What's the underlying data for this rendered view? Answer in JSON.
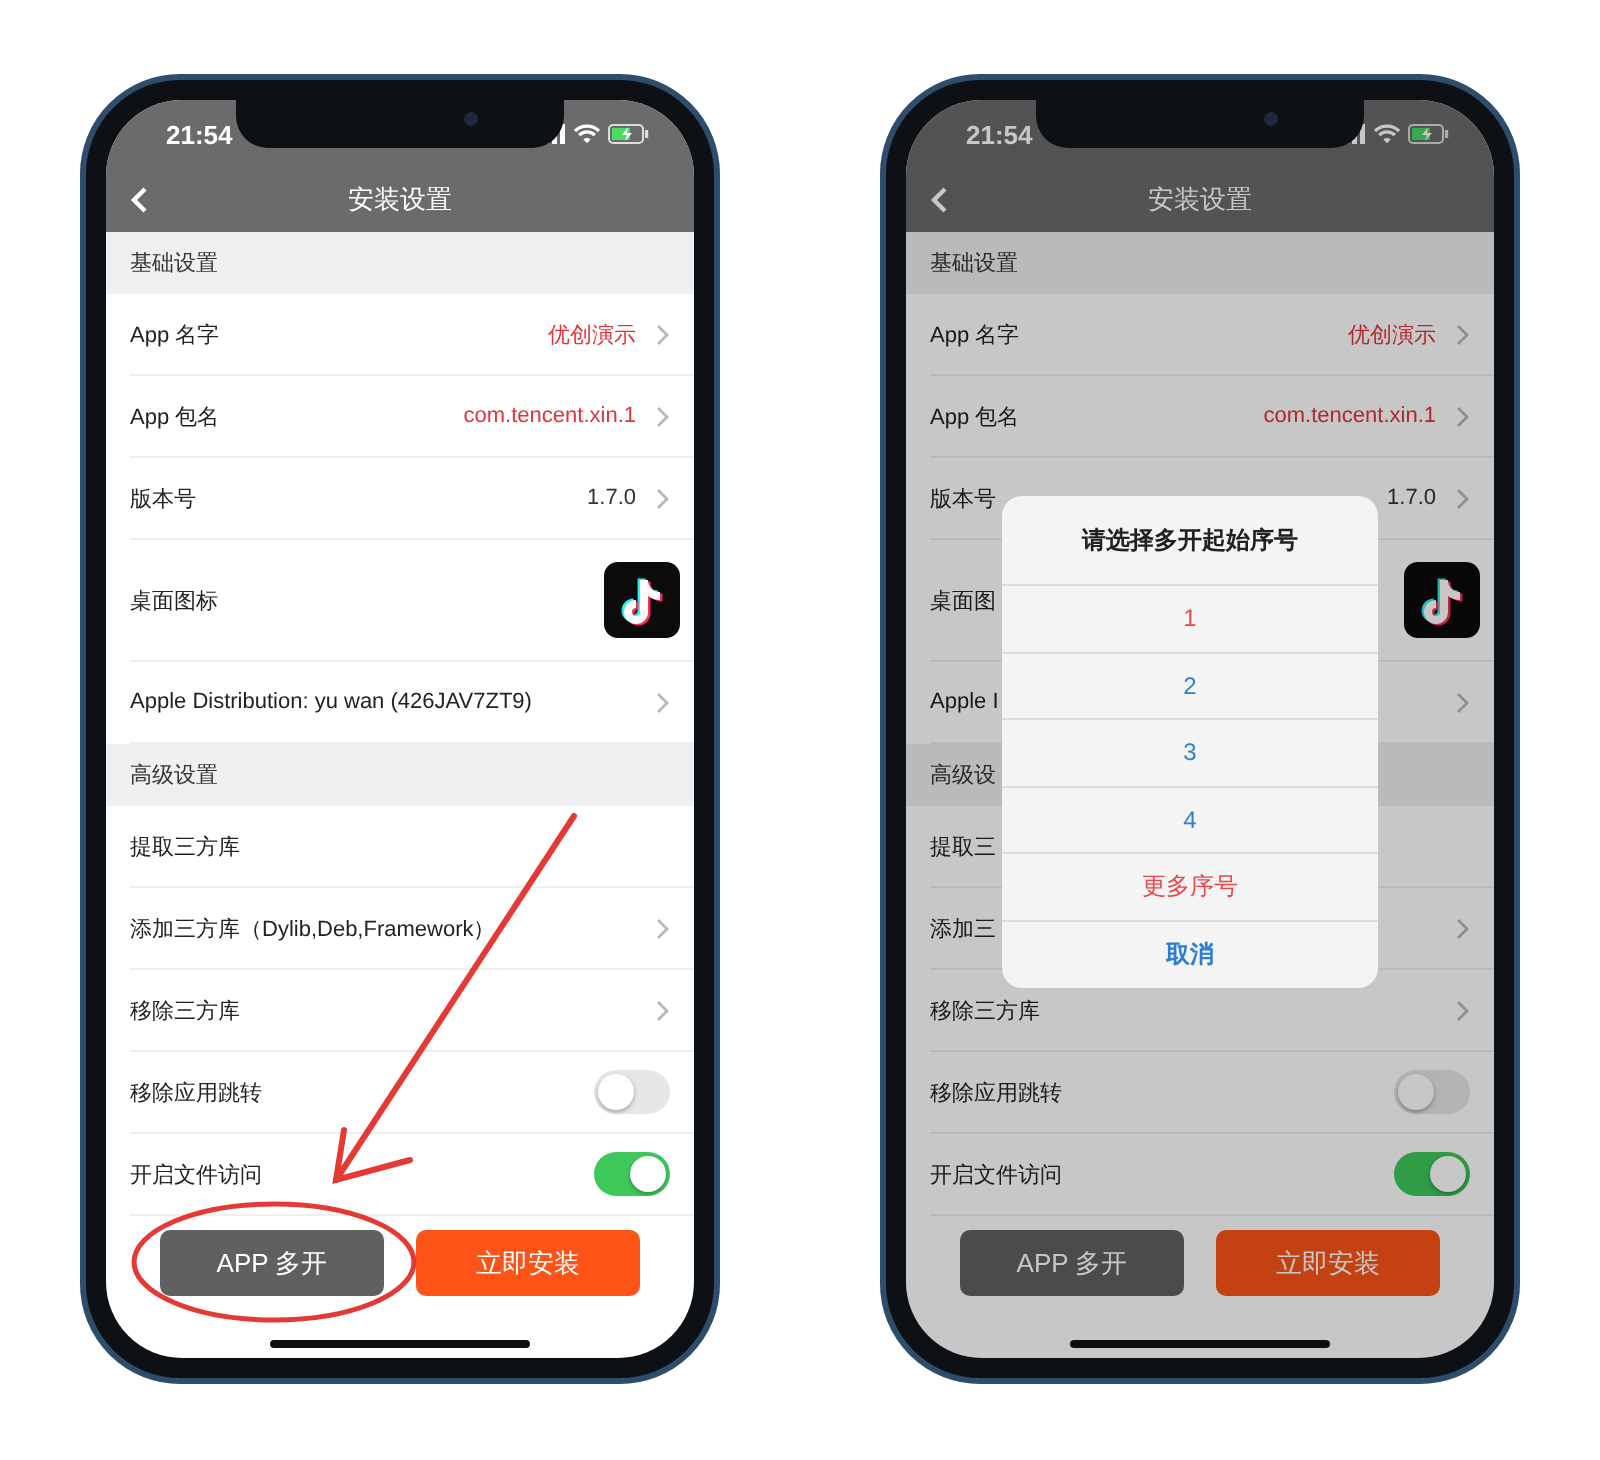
{
  "phones": [
    {
      "annotated": true,
      "status_bar": {
        "time": "21:54"
      },
      "nav": {
        "title": "安装设置"
      },
      "sections": [
        {
          "header": "基础设置",
          "rows": [
            {
              "kind": "value",
              "label": "App 名字",
              "value": "优创演示",
              "highlighted": true
            },
            {
              "kind": "value",
              "label": "App 包名",
              "value": "com.tencent.xin.1",
              "highlighted": true
            },
            {
              "kind": "value",
              "label": "版本号",
              "value": "1.7.0",
              "highlighted": false
            },
            {
              "kind": "icon",
              "label": "桌面图标"
            },
            {
              "kind": "link",
              "label": "Apple Distribution: yu wan (426JAV7ZT9)"
            }
          ]
        },
        {
          "header": "高级设置",
          "rows": [
            {
              "kind": "plain",
              "label": "提取三方库"
            },
            {
              "kind": "link",
              "label": "添加三方库（Dylib,Deb,Framework）"
            },
            {
              "kind": "link",
              "label": "移除三方库"
            },
            {
              "kind": "toggle",
              "label": "移除应用跳转",
              "on": false
            },
            {
              "kind": "toggle",
              "label": "开启文件访问",
              "on": true
            }
          ]
        }
      ],
      "buttons": [
        {
          "kind": "secondary",
          "label": "APP 多开"
        },
        {
          "kind": "primary",
          "label": "立即安装"
        }
      ]
    },
    {
      "annotated": false,
      "status_bar": {
        "time": "21:54"
      },
      "nav": {
        "title": "安装设置"
      },
      "sections": [
        {
          "header": "基础设置",
          "rows": [
            {
              "kind": "value",
              "label": "App 名字",
              "value": "优创演示",
              "highlighted": true
            },
            {
              "kind": "value",
              "label": "App 包名",
              "value": "com.tencent.xin.1",
              "highlighted": true
            },
            {
              "kind": "value",
              "label": "版本号",
              "value": "1.7.0",
              "highlighted": false
            },
            {
              "kind": "icon",
              "label": "桌面图"
            },
            {
              "kind": "link",
              "label": "Apple I"
            }
          ]
        },
        {
          "header": "高级设",
          "rows": [
            {
              "kind": "plain",
              "label": "提取三"
            },
            {
              "kind": "link",
              "label": "添加三"
            },
            {
              "kind": "link",
              "label": "移除三方库"
            },
            {
              "kind": "toggle",
              "label": "移除应用跳转",
              "on": false
            },
            {
              "kind": "toggle",
              "label": "开启文件访问",
              "on": true
            }
          ]
        }
      ],
      "buttons": [
        {
          "kind": "secondary",
          "label": "APP 多开"
        },
        {
          "kind": "primary",
          "label": "立即安装"
        }
      ],
      "dialog": {
        "title": "请选择多开起始序号",
        "options": [
          {
            "kind": "alert",
            "label": "1"
          },
          {
            "kind": "normal",
            "label": "2"
          },
          {
            "kind": "normal",
            "label": "3"
          },
          {
            "kind": "normal",
            "label": "4"
          },
          {
            "kind": "alert",
            "label": "更多序号"
          },
          {
            "kind": "cancel",
            "label": "取消"
          }
        ]
      }
    }
  ]
}
